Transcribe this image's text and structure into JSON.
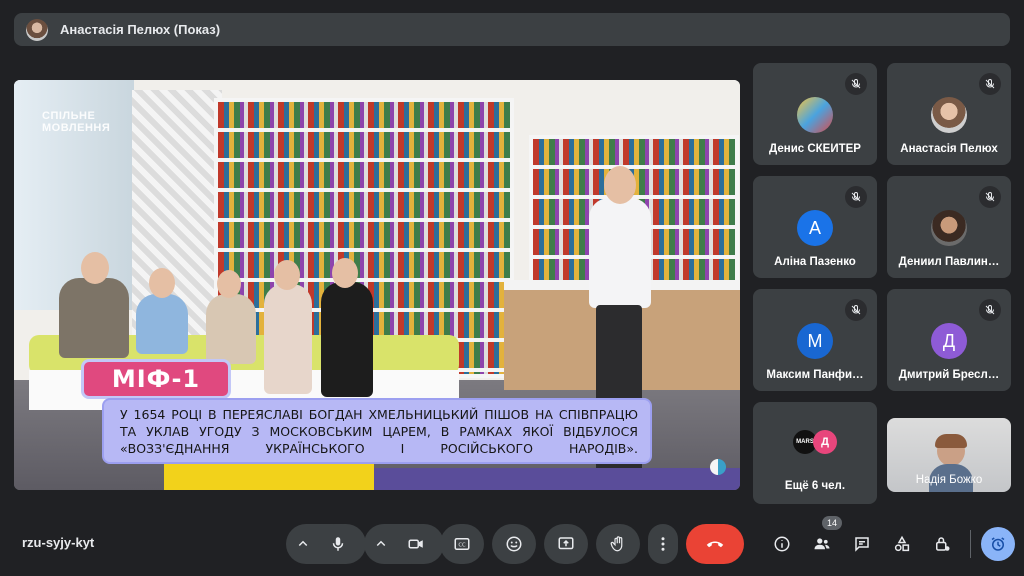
{
  "presenter": {
    "name": "Анастасія Пелюх (Показ)"
  },
  "slide": {
    "watermark_line1": "СПІЛЬНЕ",
    "watermark_line2": "МОВЛЕННЯ",
    "myth_label": "МІФ-1",
    "myth_text": "У 1654 РОЦІ В ПЕРЕЯСЛАВІ БОГДАН ХМЕЛЬНИЦЬКИЙ ПІШОВ НА СПІВПРАЦЮ ТА УКЛАВ УГОДУ З МОСКОВСЬКИМ ЦАРЕМ, В РАМКАХ ЯКОЇ ВІДБУЛОСЯ «ВОЗЗ'ЄДНАННЯ УКРАЇНСЬКОГО І РОСІЙСЬКОГО НАРОДІВ»."
  },
  "participants": [
    {
      "name": "Денис СКЕЙТЕР",
      "avatar_type": "image",
      "muted": true
    },
    {
      "name": "Анастасія Пелюх",
      "avatar_type": "image",
      "muted": true
    },
    {
      "name": "Аліна Пазенко",
      "initial": "А",
      "avatar_color": "#1a73e8",
      "muted": true
    },
    {
      "name": "Дениил Павлин…",
      "avatar_type": "image",
      "muted": true
    },
    {
      "name": "Максим Панфи…",
      "initial": "М",
      "avatar_color": "#1967d2",
      "muted": true
    },
    {
      "name": "Дмитрий Бресл…",
      "initial": "Д",
      "avatar_color": "#8e5bd6",
      "muted": true
    },
    {
      "name": "Ещё 6 чел.",
      "mini_initial_1": "MARS",
      "mini_initial_2": "Д",
      "mini_color_2": "#e8467c"
    },
    {
      "name": "Надія Божко",
      "avatar_type": "camera"
    }
  ],
  "bottom_bar": {
    "meeting_code": "rzu-syjy-kyt",
    "participants_count": "14",
    "icons": [
      "chevron-up-icon",
      "microphone-icon",
      "chevron-up-icon",
      "camera-icon",
      "captions-icon",
      "emoji-icon",
      "present-icon",
      "raise-hand-icon",
      "more-vert-icon",
      "end-call-icon",
      "info-icon",
      "people-icon",
      "chat-icon",
      "activities-icon",
      "host-controls-icon",
      "timer-icon"
    ]
  },
  "colors": {
    "background": "#202124",
    "surface": "#3c4043",
    "end_call": "#ea4335",
    "accent": "#8ab4f8",
    "myth_pink": "#e0497f",
    "myth_lavender": "#b7b8f5"
  }
}
